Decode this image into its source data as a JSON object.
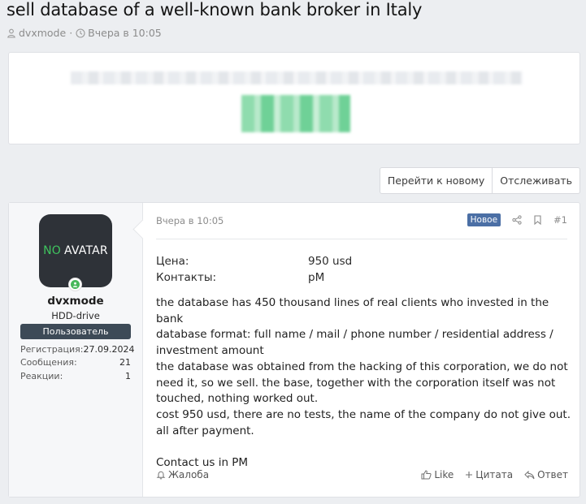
{
  "thread": {
    "title": "sell database of a well-known bank broker in Italy",
    "author": "dvxmode",
    "separator": "·",
    "date": "Вчера в 10:05"
  },
  "actions": {
    "goto_new": "Перейти к новому",
    "watch": "Отслеживать"
  },
  "user": {
    "avatar_no": "NO",
    "avatar_text": "AVATAR",
    "name": "dvxmode",
    "title": "HDD-drive",
    "banner": "Пользователь",
    "stats": [
      {
        "label": "Регистрация:",
        "value": "27.09.2024"
      },
      {
        "label": "Сообщения:",
        "value": "21"
      },
      {
        "label": "Реакции:",
        "value": "1"
      }
    ]
  },
  "post": {
    "date": "Вчера в 10:05",
    "badge": "Новое",
    "number": "#1",
    "fields": [
      {
        "label": "Цена:",
        "value": "950 usd"
      },
      {
        "label": "Контакты:",
        "value": "pM"
      }
    ],
    "lines": [
      "the database has 450 thousand lines of real clients who invested in the bank",
      "database format: full name / mail / phone number / residential address / investment amount",
      "the database was obtained from the hacking of this corporation, we do not need it, so we sell. the base, together with the corporation itself was not touched, nothing worked out.",
      "cost 950 usd, there are no tests, the name of the company do not give out. all after payment."
    ],
    "contact": "Contact us in PM",
    "report": "Жалоба",
    "like": "Like",
    "quote": "Цитата",
    "reply": "Ответ"
  },
  "colors": {
    "badge": "#4b6fa5",
    "banner": "#3d4a57",
    "online": "#47b85b",
    "avatar_bg": "#2e3238",
    "avatar_no": "#3fc45e"
  }
}
